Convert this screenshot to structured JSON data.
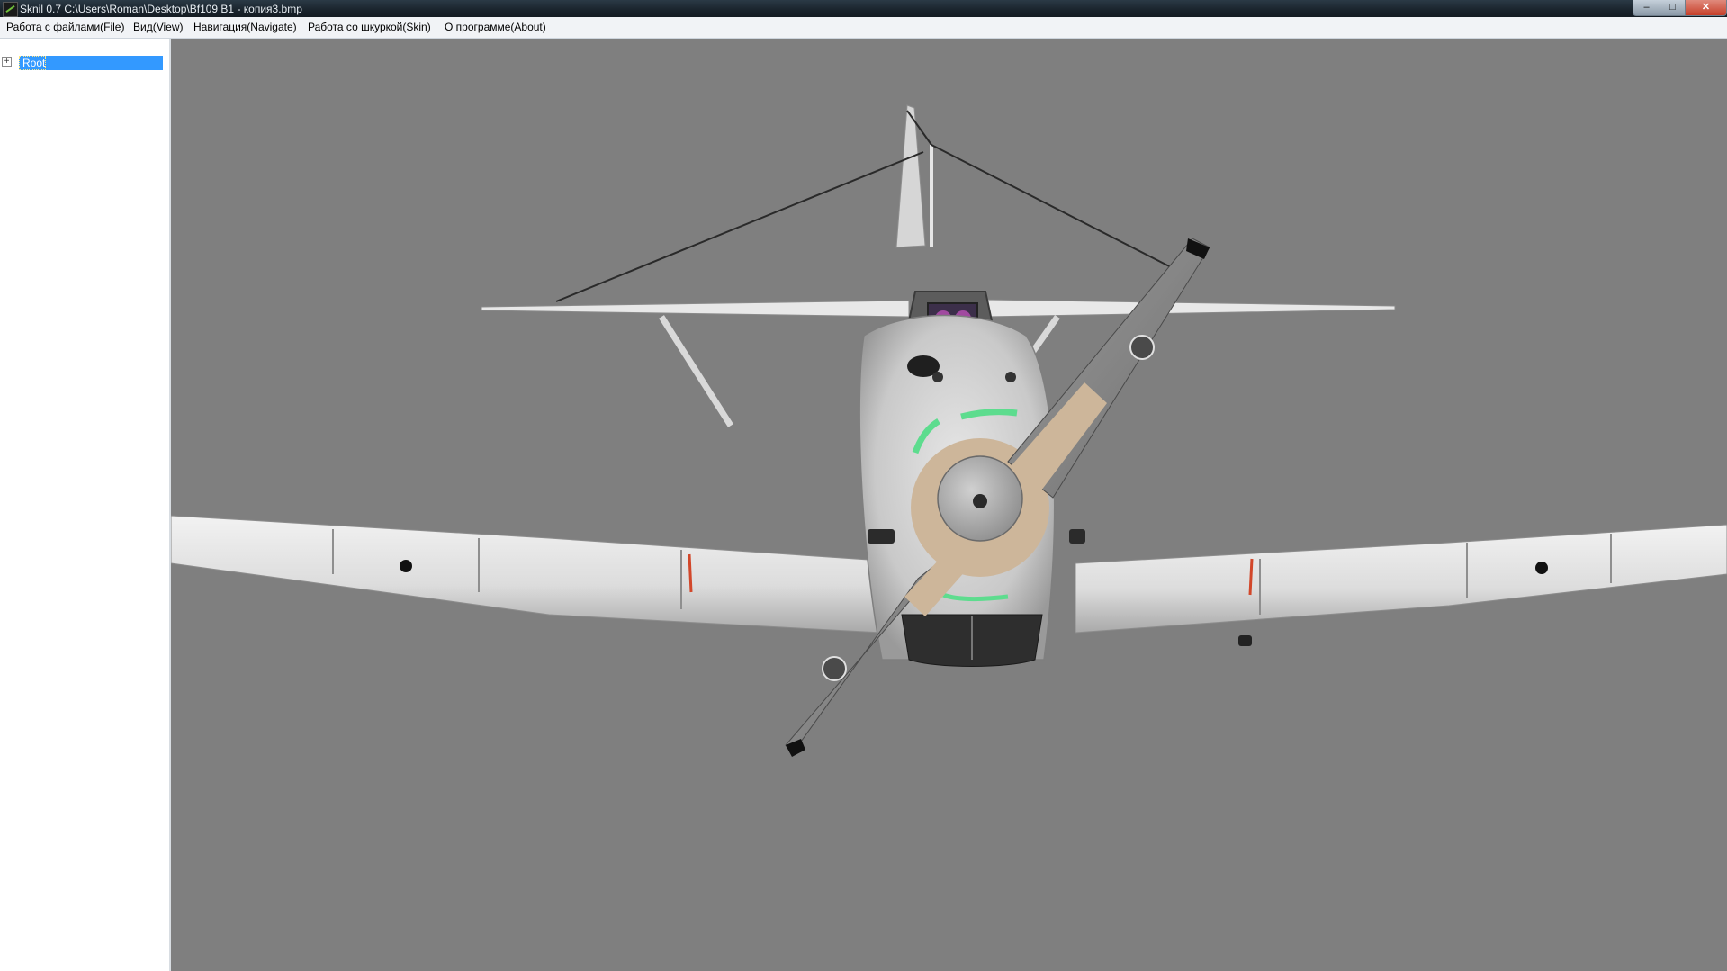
{
  "window": {
    "title": "Sknil 0.7   C:\\Users\\Roman\\Desktop\\Bf109 B1 - копия3.bmp",
    "controls": {
      "minimize": "–",
      "maximize": "□",
      "close": "✕"
    }
  },
  "menu": {
    "items": [
      {
        "label": "Работа с файлами(File)"
      },
      {
        "label": "Вид(View)"
      },
      {
        "label": "Навигация(Navigate)"
      },
      {
        "label": "Работа со шкуркой(Skin)"
      },
      {
        "label": "О программе(About)"
      }
    ]
  },
  "tree": {
    "root": {
      "label": "Root",
      "expander": "+"
    }
  },
  "viewport": {
    "background": "#7f7f7f",
    "content": "3d-aircraft-model"
  }
}
